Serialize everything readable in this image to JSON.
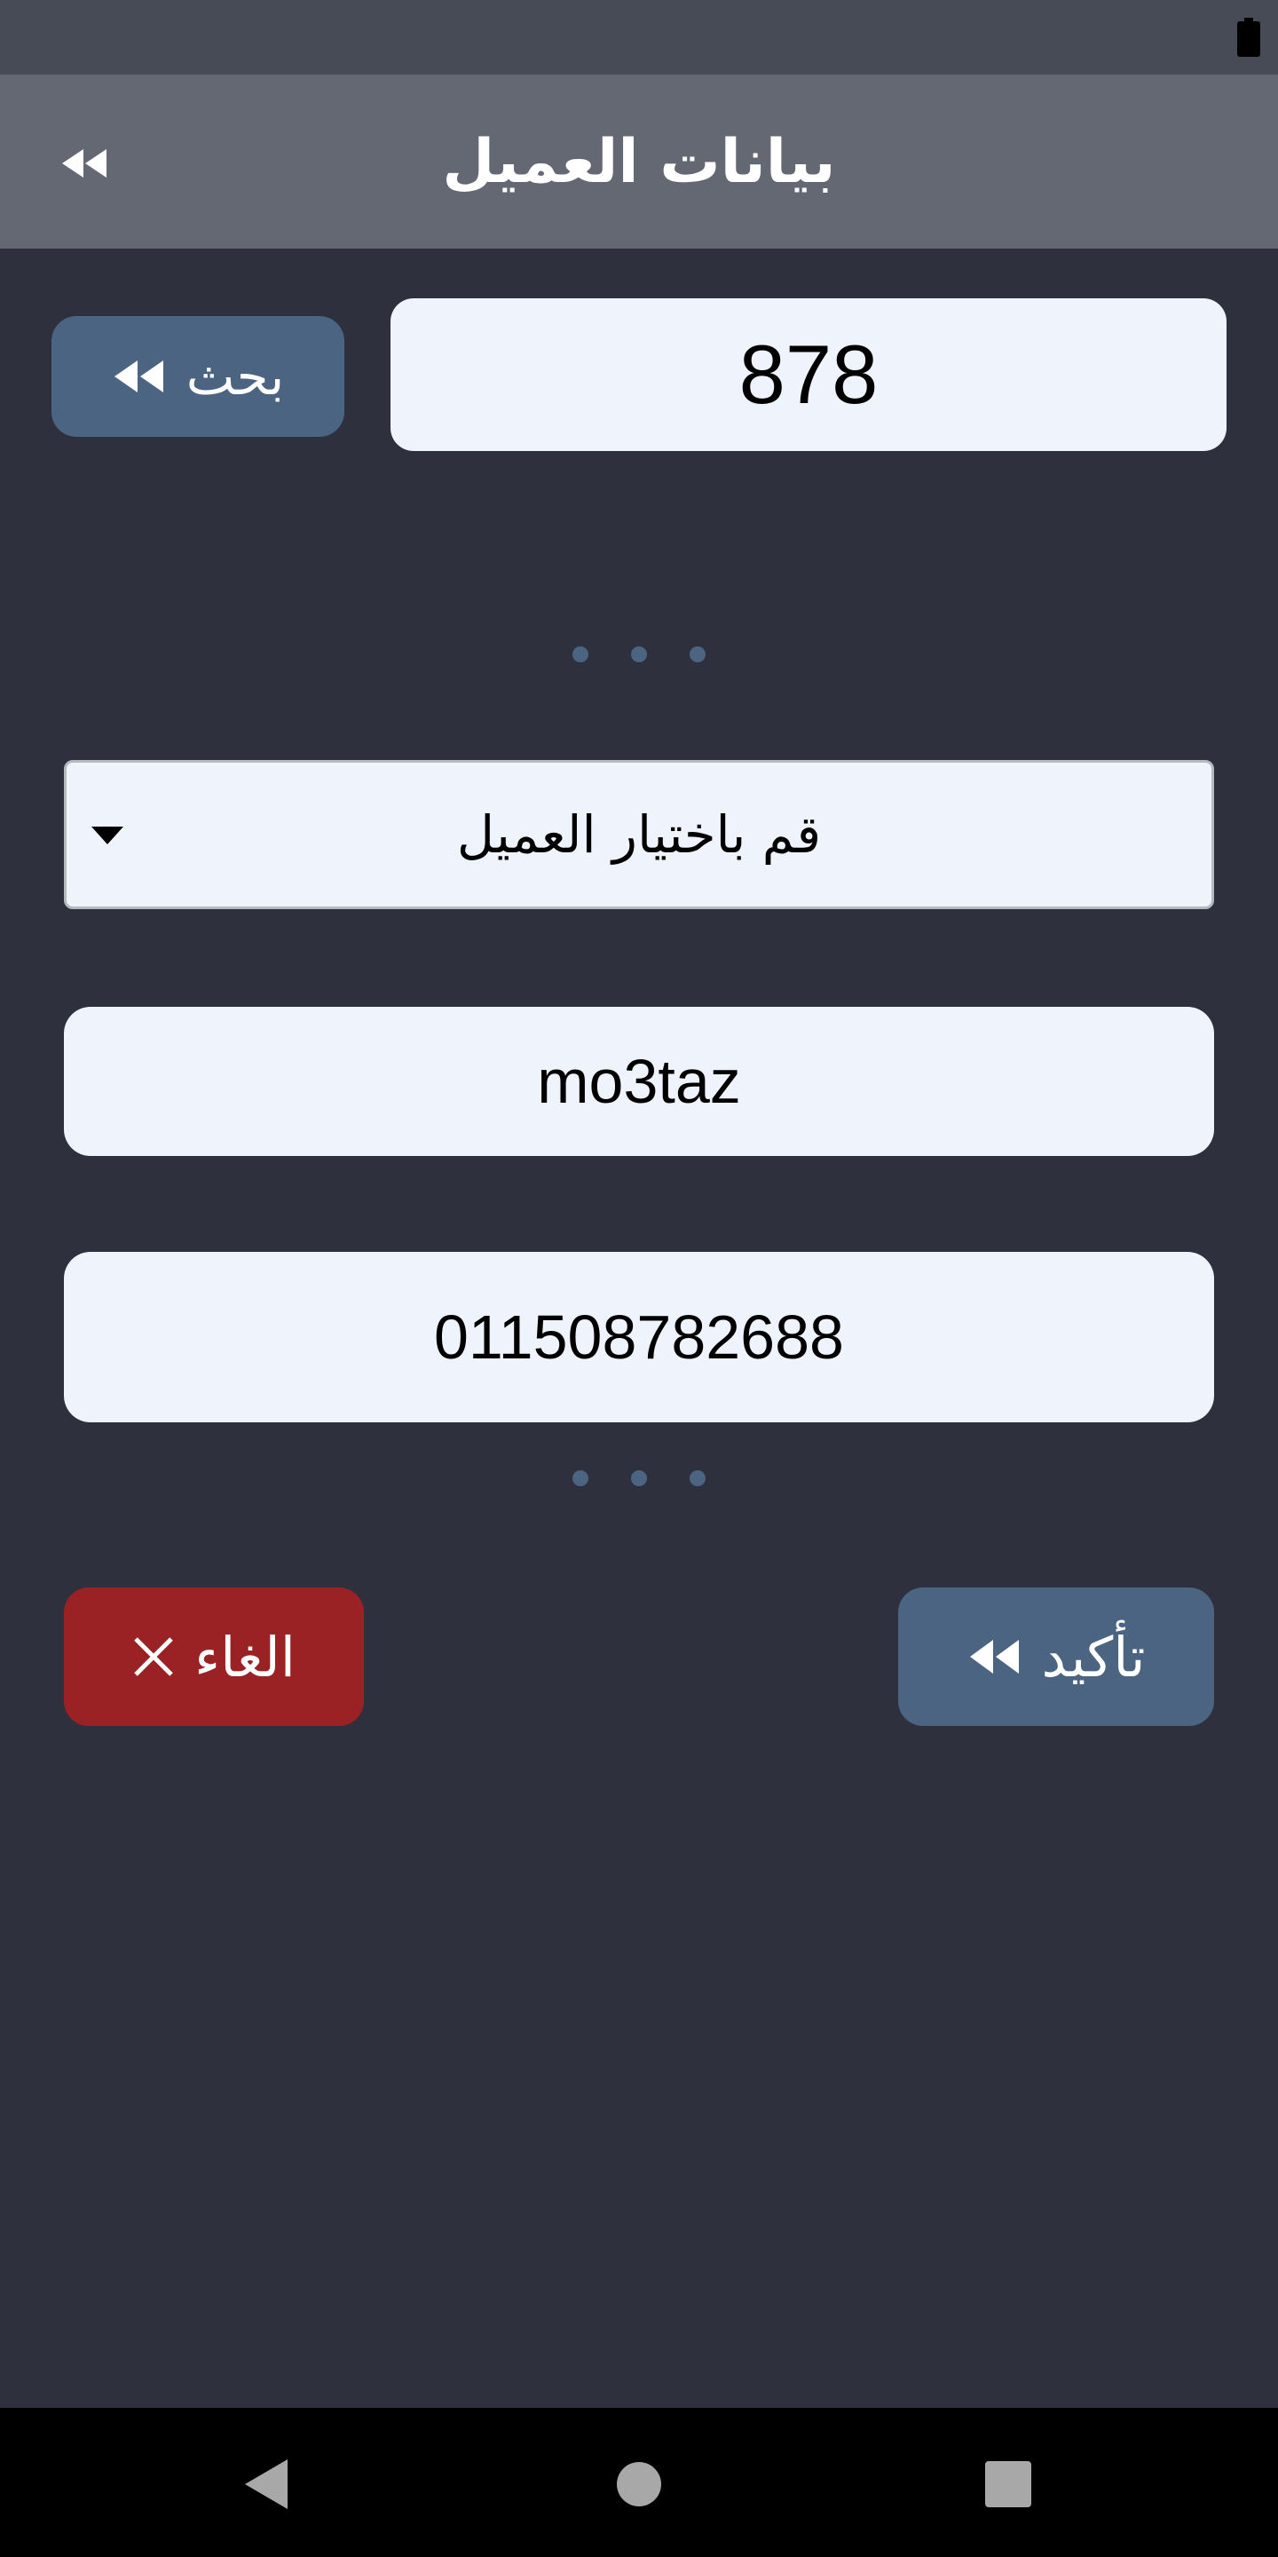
{
  "header": {
    "title": "بيانات العميل"
  },
  "search": {
    "value": "878",
    "button_label": "بحث"
  },
  "customer_select": {
    "selected": "قم باختيار العميل"
  },
  "customer_name": {
    "value": "mo3taz"
  },
  "customer_phone": {
    "value": "011508782688"
  },
  "actions": {
    "confirm_label": "تأكيد",
    "cancel_label": "الغاء"
  },
  "colors": {
    "background": "#2e303d",
    "app_bar": "#646873",
    "accent": "#4a6482",
    "danger": "#9a2225",
    "field_background": "#eef3fc"
  },
  "icons": {
    "back": "double-chevron-left-icon",
    "search": "double-chevron-left-icon",
    "confirm": "double-chevron-left-icon",
    "cancel": "close-icon",
    "battery": "battery-icon",
    "nav_back": "triangle-back-icon",
    "nav_home": "circle-home-icon",
    "nav_recents": "square-recents-icon"
  }
}
